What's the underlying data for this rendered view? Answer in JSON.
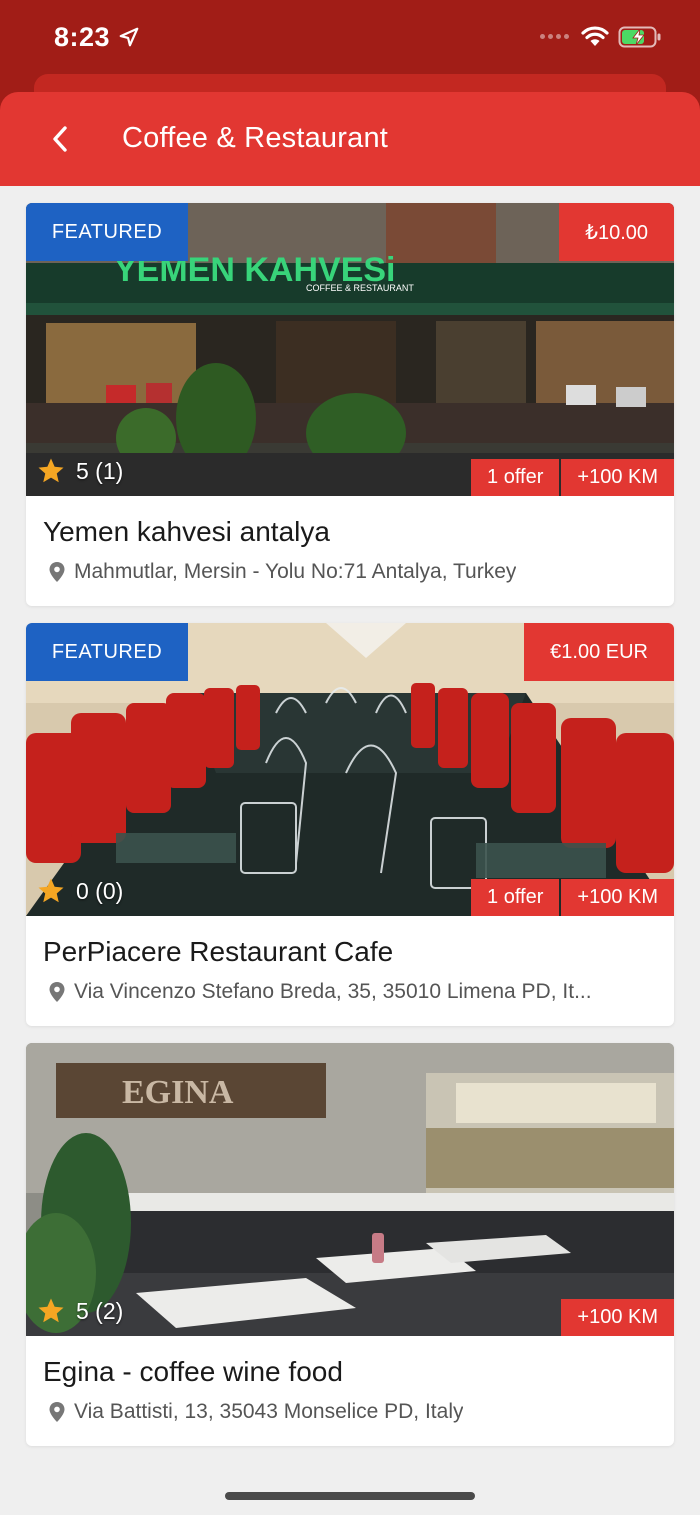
{
  "status_bar": {
    "time": "8:23"
  },
  "nav": {
    "title": "Coffee & Restaurant"
  },
  "colors": {
    "accent": "#e23732",
    "featured": "#1e62c3",
    "status_bar": "#a11d17",
    "star": "#f5a623"
  },
  "listings": [
    {
      "featured_label": "FEATURED",
      "price": "₺10.00",
      "rating": "5 (1)",
      "offer": "1 offer",
      "distance": "+100 KM",
      "name": "Yemen kahvesi antalya",
      "address": "Mahmutlar, Mersin - Yolu No:71 Antalya, Turkey",
      "sign_text": "YEMEN KAHVESi",
      "sign_subtext": "COFFEE & RESTAURANT"
    },
    {
      "featured_label": "FEATURED",
      "price": "€1.00 EUR",
      "rating": "0 (0)",
      "offer": "1 offer",
      "distance": "+100 KM",
      "name": "PerPiacere Restaurant Cafe",
      "address": "Via Vincenzo Stefano Breda, 35, 35010 Limena PD, It..."
    },
    {
      "rating": "5 (2)",
      "distance": "+100 KM",
      "name": "Egina - coffee wine food",
      "address": "Via Battisti, 13, 35043 Monselice PD, Italy",
      "sign_text": "EGINA"
    }
  ]
}
